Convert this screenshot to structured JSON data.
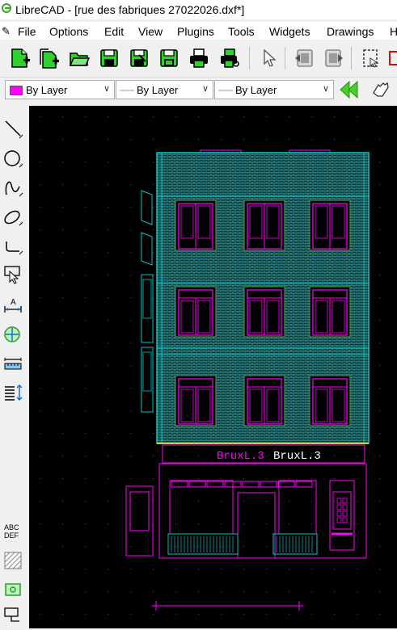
{
  "window": {
    "title": "LibreCAD - [rue des fabriques 27022026.dxf*]"
  },
  "menu": {
    "items": [
      "File",
      "Options",
      "Edit",
      "View",
      "Plugins",
      "Tools",
      "Widgets",
      "Drawings",
      "H"
    ]
  },
  "toolbar_main": {
    "buttons": [
      "new-file-icon",
      "new-from-template-icon",
      "open-folder-icon",
      "save-icon",
      "save-as-icon",
      "save-all-icon",
      "print-icon",
      "print-preview-icon",
      "select-pointer-icon",
      "undo-icon",
      "redo-icon",
      "selection-rect-icon",
      "red-tool-icon"
    ]
  },
  "pen_toolbar": {
    "color_label": "By Layer",
    "color_hex": "#ff00ff",
    "linetype_label": "By Layer",
    "linewidth_label": "By Layer"
  },
  "left_tools": {
    "icons": [
      "line-tool-icon",
      "circle-tool-icon",
      "spline-tool-icon",
      "ellipse-tool-icon",
      "polyline-tool-icon",
      "select-tool-icon",
      "dimension-tool-icon",
      "modify-tool-icon",
      "measure-tool-icon",
      "order-tool-icon",
      "text-tool-icon",
      "hatch-tool-icon",
      "image-tool-icon",
      "block-tool-icon"
    ]
  },
  "drawing": {
    "labels": [
      "BruxL.3",
      "BruxL.3"
    ],
    "colors": {
      "facade": "#00c8c8",
      "windows": "#ff00ff",
      "sill": "#ffff00",
      "grid": "#3a3a3a"
    }
  }
}
